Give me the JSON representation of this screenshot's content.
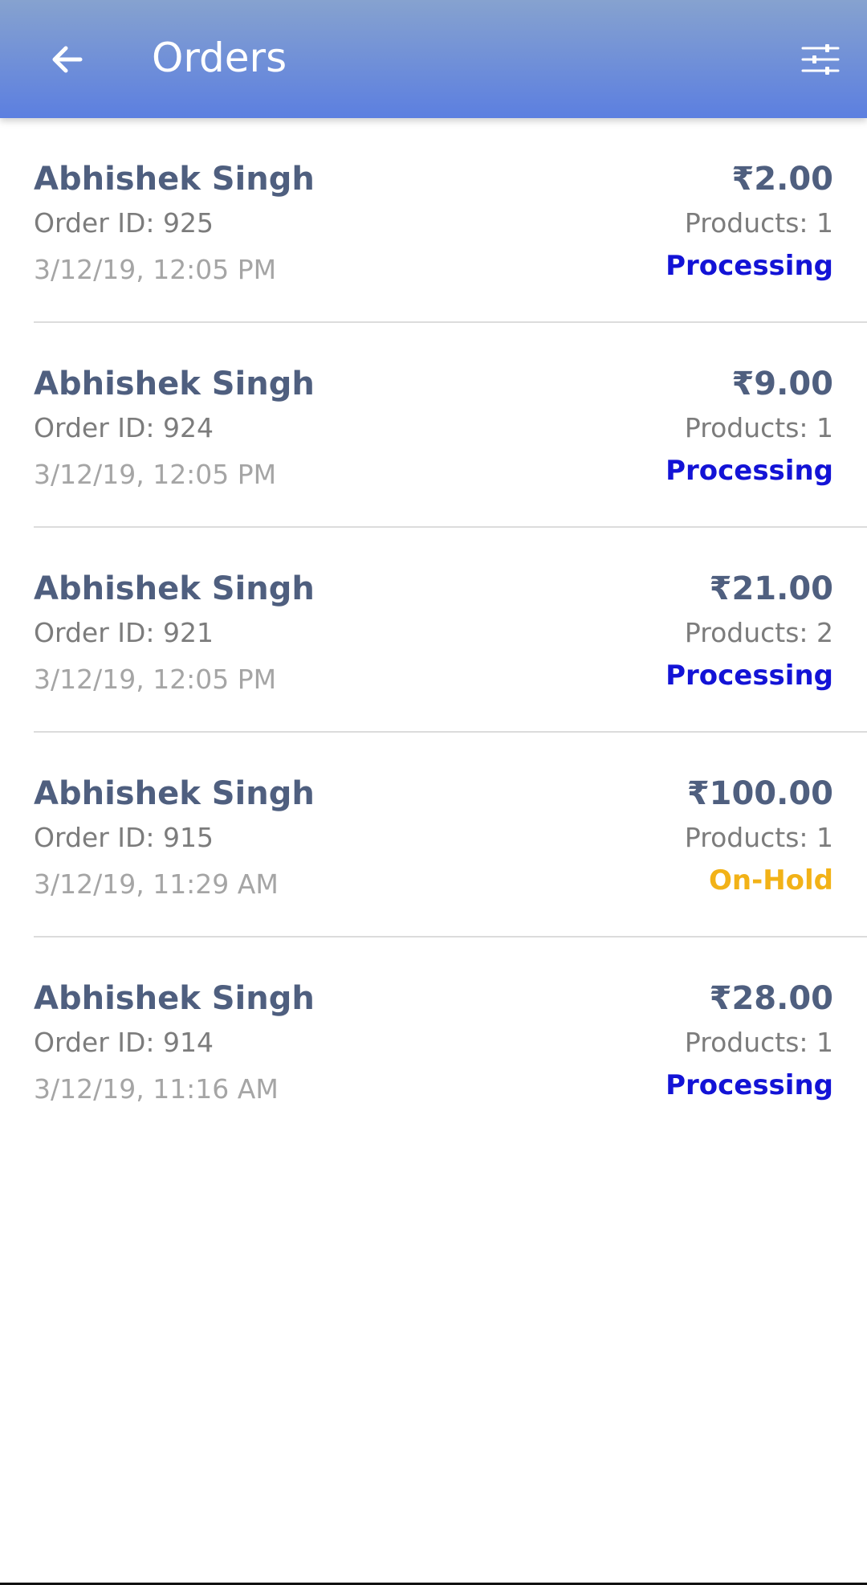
{
  "header": {
    "title": "Orders",
    "back_icon": "arrow-left-icon",
    "filter_icon": "sliders-icon"
  },
  "colors": {
    "header_top": "#86a2cf",
    "header_bottom": "#5c7fe0",
    "name": "#4f5f7f",
    "processing": "#1313d6",
    "on_hold": "#f2b217"
  },
  "orders": [
    {
      "customer": "Abhishek Singh",
      "order_id": "Order ID: 925",
      "date": "3/12/19, 12:05 PM",
      "total": "₹2.00",
      "products": "Products: 1",
      "status": "Processing",
      "status_color": "#1313d6"
    },
    {
      "customer": "Abhishek Singh",
      "order_id": "Order ID: 924",
      "date": "3/12/19, 12:05 PM",
      "total": "₹9.00",
      "products": "Products: 1",
      "status": "Processing",
      "status_color": "#1313d6"
    },
    {
      "customer": "Abhishek Singh",
      "order_id": "Order ID: 921",
      "date": "3/12/19, 12:05 PM",
      "total": "₹21.00",
      "products": "Products: 2",
      "status": "Processing",
      "status_color": "#1313d6"
    },
    {
      "customer": "Abhishek Singh",
      "order_id": "Order ID: 915",
      "date": "3/12/19, 11:29 AM",
      "total": "₹100.00",
      "products": "Products: 1",
      "status": "On-Hold",
      "status_color": "#f2b217"
    },
    {
      "customer": "Abhishek Singh",
      "order_id": "Order ID: 914",
      "date": "3/12/19, 11:16 AM",
      "total": "₹28.00",
      "products": "Products: 1",
      "status": "Processing",
      "status_color": "#1313d6"
    }
  ]
}
